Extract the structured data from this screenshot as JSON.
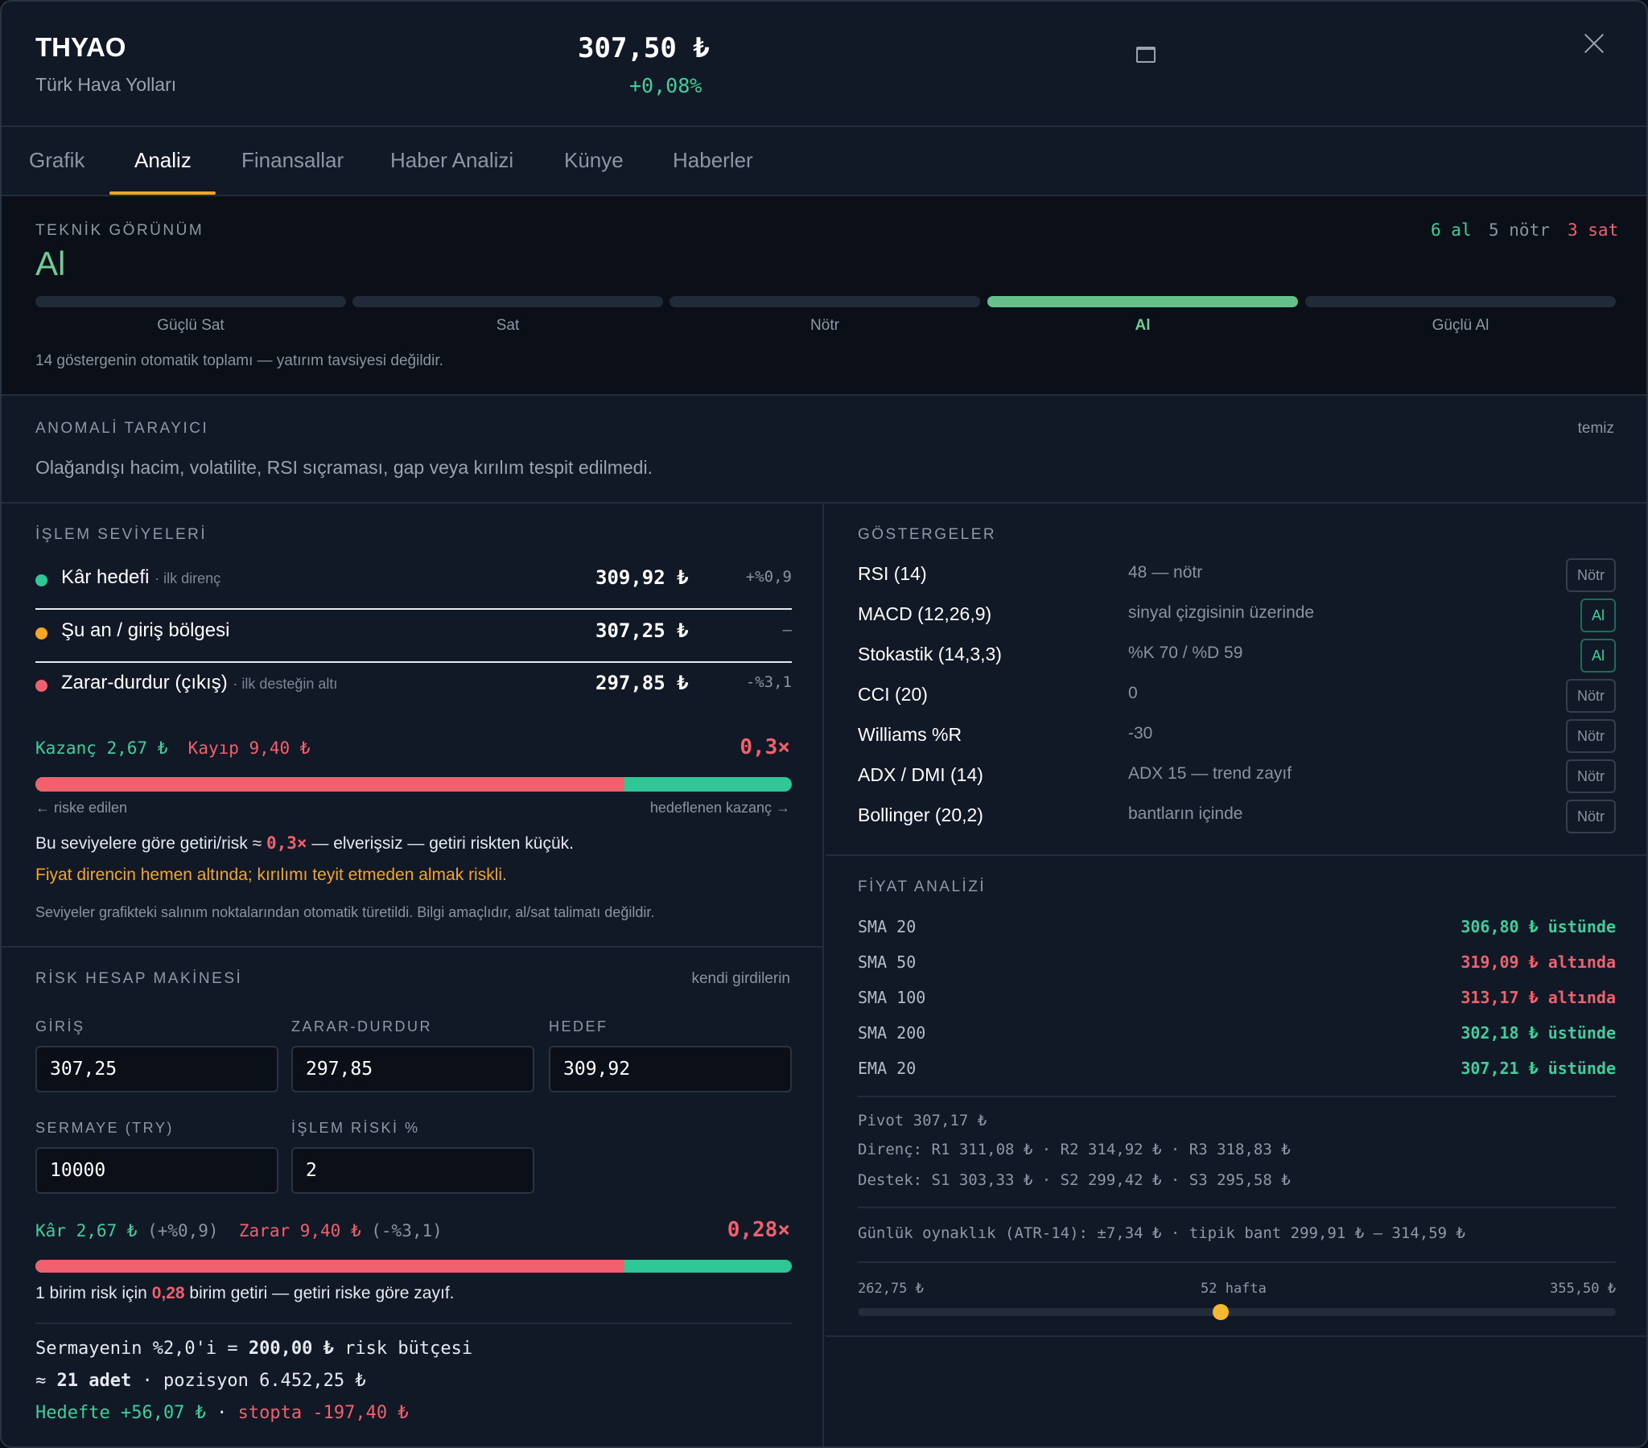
{
  "header": {
    "symbol": "THYAO",
    "name": "Türk Hava Yolları",
    "price": "307,50 ₺",
    "change": "+0,08%"
  },
  "tabs": [
    "Grafik",
    "Analiz",
    "Finansallar",
    "Haber Analizi",
    "Künye",
    "Haberler"
  ],
  "active_tab": "Analiz",
  "technical": {
    "heading": "TEKNİK GÖRÜNÜM",
    "verdict": "Al",
    "counts": {
      "buy": "6 al",
      "neutral": "5 nötr",
      "sell": "3 sat"
    },
    "scale": [
      "Güçlü Sat",
      "Sat",
      "Nötr",
      "Al",
      "Güçlü Al"
    ],
    "active_index": 3,
    "note": "14 göstergenin otomatik toplamı — yatırım tavsiyesi değildir."
  },
  "anomaly": {
    "heading": "ANOMALİ TARAYICI",
    "status": "temiz",
    "text": "Olağandışı hacim, volatilite, RSI sıçraması, gap veya kırılım tespit edilmedi."
  },
  "levels": {
    "heading": "İŞLEM SEVİYELERİ",
    "rows": [
      {
        "label": "Kâr hedefi",
        "sub": "· ilk direnç",
        "value": "309,92 ₺",
        "pct": "+%0,9",
        "color": "#2fc796"
      },
      {
        "label": "Şu an / giriş bölgesi",
        "sub": "",
        "value": "307,25 ₺",
        "pct": "–",
        "color": "#f5a524"
      },
      {
        "label": "Zarar-durdur (çıkış)",
        "sub": "· ilk desteğin altı",
        "value": "297,85 ₺",
        "pct": "-%3,1",
        "color": "#f0616d"
      }
    ],
    "gain": "Kazanç 2,67 ₺",
    "loss": "Kayıp 9,40 ₺",
    "ratio": "0,3×",
    "risk_fraction": 0.779,
    "risk_label": "← riske edilen",
    "reward_label": "hedeflenen kazanç →",
    "summary_pre": "Bu seviyelere göre getiri/risk ≈ ",
    "summary_ratio": "0,3×",
    "summary_post": " — elverişsiz — getiri riskten küçük.",
    "warning": "Fiyat direncin hemen altında; kırılımı teyit etmeden almak riskli.",
    "footnote": "Seviyeler grafikteki salınım noktalarından otomatik türetildi. Bilgi amaçlıdır, al/sat talimatı değildir."
  },
  "calculator": {
    "heading": "RİSK HESAP MAKİNESİ",
    "hint": "kendi girdilerin",
    "fields": {
      "entry_label": "GİRİŞ",
      "entry": "307,25",
      "stop_label": "ZARAR-DURDUR",
      "stop": "297,85",
      "target_label": "HEDEF",
      "target": "309,92",
      "capital_label": "SERMAYE (TRY)",
      "capital": "10000",
      "risk_label": "İŞLEM RİSKİ %",
      "risk": "2"
    },
    "profit": "Kâr 2,67 ₺ ",
    "profit_pct": "(+%0,9)",
    "loss": "Zarar 9,40 ₺ ",
    "loss_pct": "(-%3,1)",
    "ratio": "0,28×",
    "risk_fraction": 0.779,
    "desc_pre": "1 birim risk için ",
    "desc_val": "0,28",
    "desc_post": " birim getiri — getiri riske göre zayıf.",
    "budget_pre": "Sermayenin %2,0'i = ",
    "budget_val": "200,00 ₺",
    "budget_post": " risk bütçesi",
    "qty_pre": "≈ ",
    "qty_val": "21 adet",
    "qty_post": " · pozisyon 6.452,25 ₺",
    "target_pl": "Hedefte +56,07 ₺",
    "sep": " · ",
    "stop_pl": "stopta -197,40 ₺"
  },
  "indicators": {
    "heading": "GÖSTERGELER",
    "rows": [
      {
        "name": "RSI (14)",
        "desc": "48 — nötr",
        "signal": "Nötr"
      },
      {
        "name": "MACD (12,26,9)",
        "desc": "sinyal çizgisinin üzerinde",
        "signal": "Al"
      },
      {
        "name": "Stokastik (14,3,3)",
        "desc": "%K 70 / %D 59",
        "signal": "Al"
      },
      {
        "name": "CCI (20)",
        "desc": "0",
        "signal": "Nötr"
      },
      {
        "name": "Williams %R",
        "desc": "-30",
        "signal": "Nötr"
      },
      {
        "name": "ADX / DMI (14)",
        "desc": "ADX 15 — trend zayıf",
        "signal": "Nötr"
      },
      {
        "name": "Bollinger (20,2)",
        "desc": "bantların içinde",
        "signal": "Nötr"
      }
    ]
  },
  "price_analysis": {
    "heading": "FİYAT ANALİZİ",
    "mas": [
      {
        "name": "SMA 20",
        "value": "306,80 ₺ üstünde",
        "dir": "up"
      },
      {
        "name": "SMA 50",
        "value": "319,09 ₺ altında",
        "dir": "dn"
      },
      {
        "name": "SMA 100",
        "value": "313,17 ₺ altında",
        "dir": "dn"
      },
      {
        "name": "SMA 200",
        "value": "302,18 ₺ üstünde",
        "dir": "up"
      },
      {
        "name": "EMA 20",
        "value": "307,21 ₺ üstünde",
        "dir": "up"
      }
    ],
    "pivot": "Pivot 307,17 ₺",
    "resistance": "Direnç: R1 311,08 ₺ · R2 314,92 ₺ · R3 318,83 ₺",
    "support": "Destek: S1 303,33 ₺ · S2 299,42 ₺ · S3 295,58 ₺",
    "atr": "Günlük oynaklık (ATR-14): ±7,34 ₺ · tipik bant 299,91 ₺ – 314,59 ₺",
    "range_low": "262,75 ₺",
    "range_label": "52 hafta",
    "range_high": "355,50 ₺",
    "range_position": 0.479
  }
}
